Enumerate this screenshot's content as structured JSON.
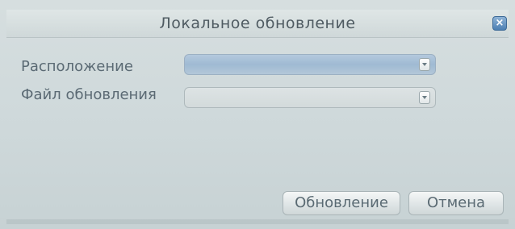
{
  "dialog": {
    "title": "Локальное обновление",
    "close_icon": "close-icon"
  },
  "form": {
    "location": {
      "label": "Расположение",
      "value": ""
    },
    "update_file": {
      "label": "Файл обновления",
      "value": ""
    }
  },
  "buttons": {
    "update_label": "Обновление",
    "cancel_label": "Отмена"
  },
  "colors": {
    "dialog_bg": "#cfd9db",
    "text": "#5b6a74",
    "location_select_bg": "#b4c9dd",
    "close_button": "#4c7fb3"
  }
}
